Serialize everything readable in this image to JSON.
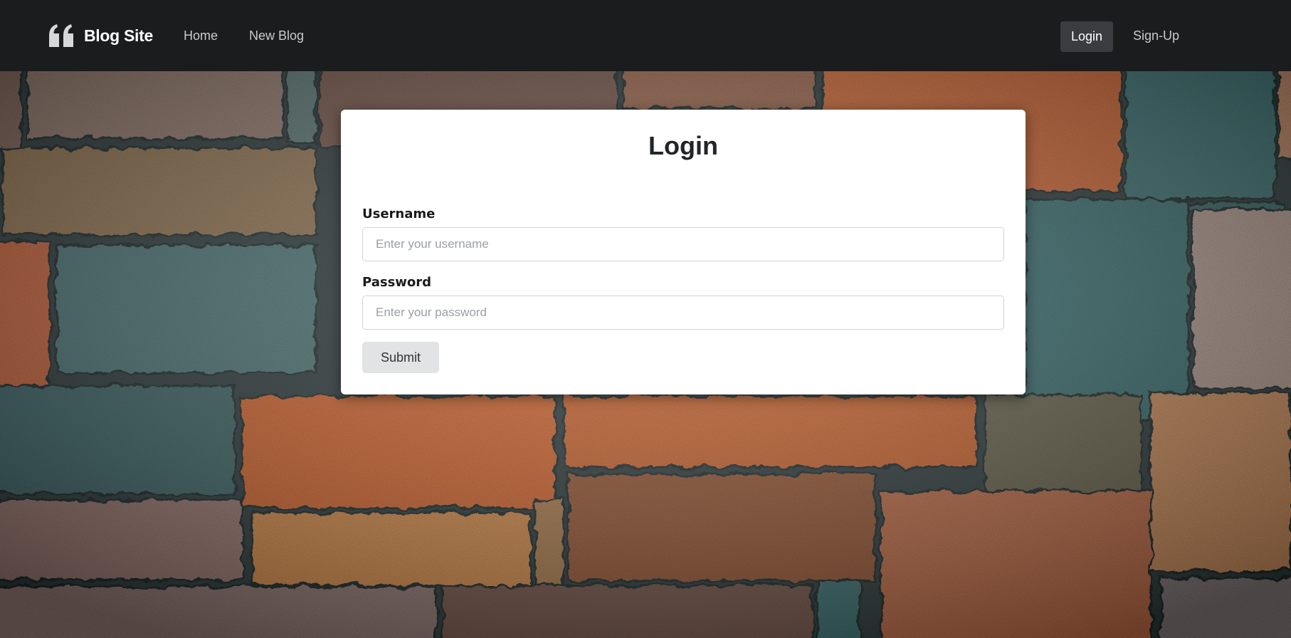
{
  "nav": {
    "brand": "Blog Site",
    "links": {
      "home": "Home",
      "new_blog": "New Blog",
      "login": "Login",
      "signup": "Sign-Up"
    }
  },
  "login_form": {
    "title": "Login",
    "username_label": "Username",
    "username_placeholder": "Enter your username",
    "password_label": "Password",
    "password_placeholder": "Enter your password",
    "submit_label": "Submit"
  },
  "icons": {
    "brand": "quote-icon"
  },
  "colors": {
    "navbar_bg": "#1b1c1e",
    "active_nav_bg": "#3a3c3f",
    "card_bg": "#ffffff",
    "submit_bg": "#e2e3e5"
  }
}
